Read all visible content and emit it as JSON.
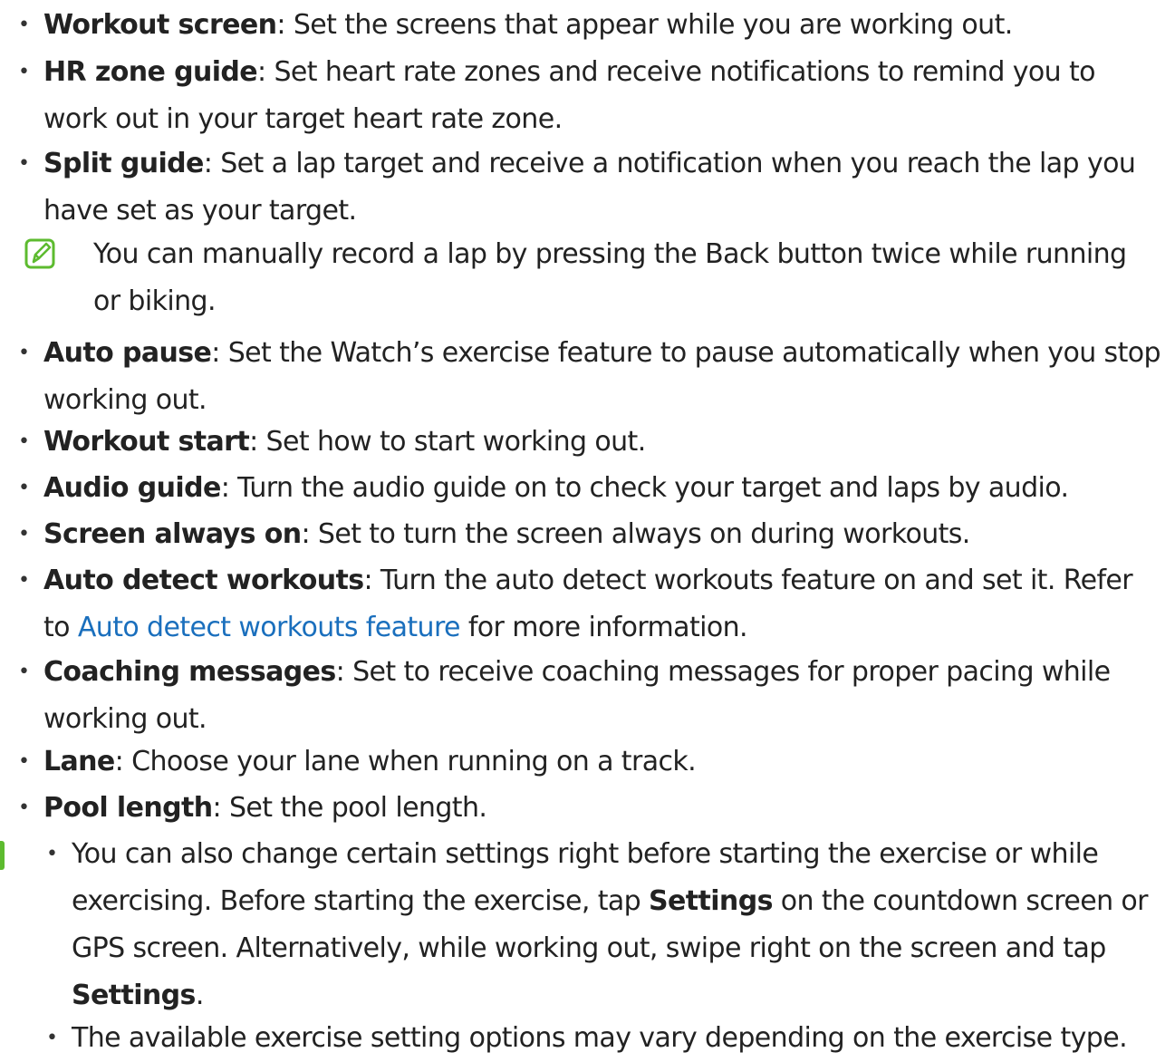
{
  "items": [
    {
      "term": "Workout screen",
      "lines": [
        ": Set the screens that appear while you are working out."
      ]
    },
    {
      "term": "HR zone guide",
      "lines": [
        ": Set heart rate zones and receive notifications to remind you to",
        "work out in your target heart rate zone."
      ]
    },
    {
      "term": "Split guide",
      "lines": [
        ": Set a lap target and receive a notification when you reach the lap you",
        "have set as your target."
      ]
    },
    {
      "term": "Auto pause",
      "lines": [
        ": Set the Watch’s exercise feature to pause automatically when you stop",
        "working out."
      ]
    },
    {
      "term": "Workout start",
      "lines": [
        ": Set how to start working out."
      ]
    },
    {
      "term": "Audio guide",
      "lines": [
        ": Turn the audio guide on to check your target and laps by audio."
      ]
    },
    {
      "term": "Screen always on",
      "lines": [
        ": Set to turn the screen always on during workouts."
      ]
    },
    {
      "term": "Auto detect workouts",
      "lines": [
        ": Turn the auto detect workouts feature on and set it. Refer"
      ],
      "line2_pre": "to ",
      "line2_link": "Auto detect workouts feature",
      "line2_post": " for more information."
    },
    {
      "term": "Coaching messages",
      "lines": [
        ": Set to receive coaching messages for proper pacing while",
        "working out."
      ]
    },
    {
      "term": "Lane",
      "lines": [
        ": Choose your lane when running on a track."
      ]
    },
    {
      "term": "Pool length",
      "lines": [
        ": Set the pool length."
      ]
    }
  ],
  "note": {
    "icon": "note-icon",
    "lines": [
      "You can manually record a lap by pressing the Back button twice while running",
      "or biking."
    ]
  },
  "tips": {
    "icon": "warning-icon",
    "first": {
      "line1": "You can also change certain settings right before starting the exercise or while",
      "line2_pre": "exercising. Before starting the exercise, tap ",
      "line2_bold": "Settings",
      "line2_post": " on the countdown screen or",
      "line3": "GPS screen. Alternatively, while working out, swipe right on the screen and tap",
      "line4_bold": "Settings",
      "line4_post": "."
    },
    "second": "The available exercise setting options may vary depending on the exercise type."
  }
}
